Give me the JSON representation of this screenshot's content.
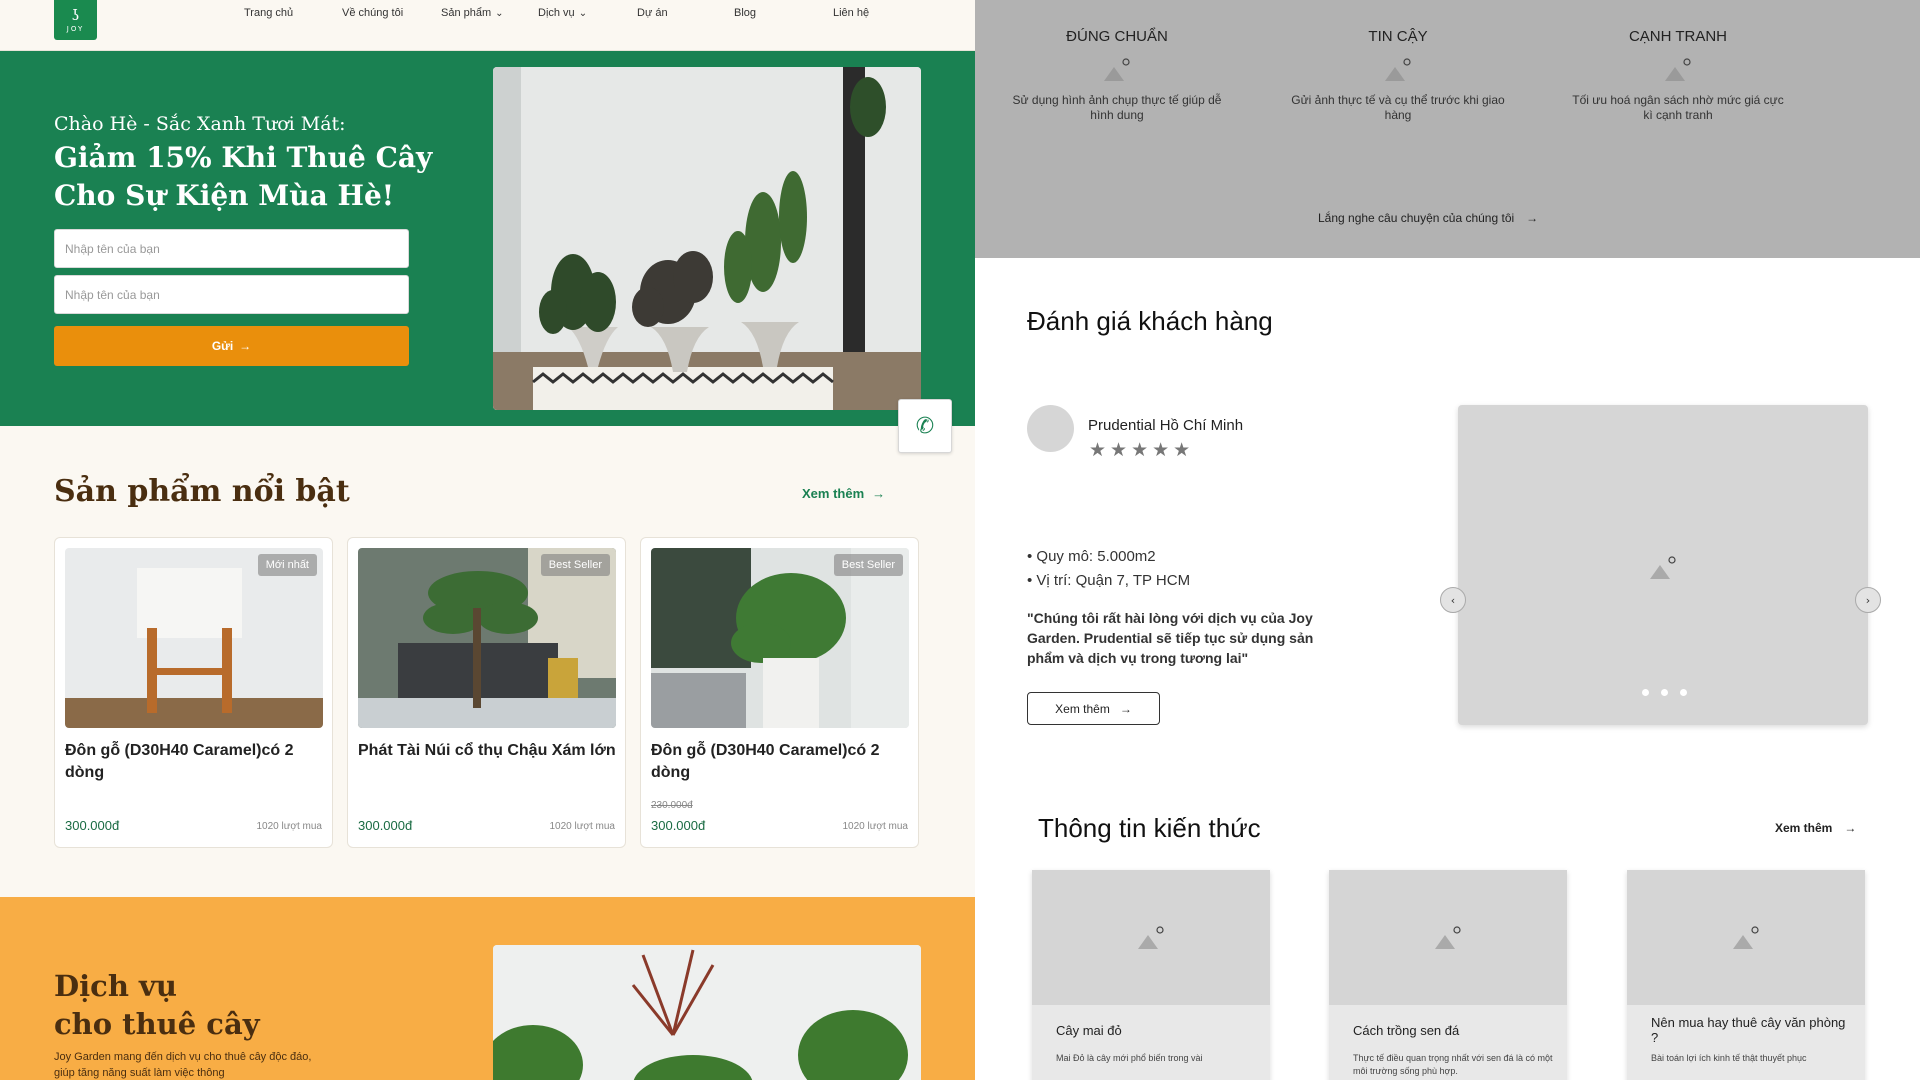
{
  "left": {
    "logo_text": "JOY",
    "nav": [
      "Trang chủ",
      "Về chúng tôi",
      "Sản phẩm",
      "Dịch vụ",
      "Dự án",
      "Blog",
      "Liên hệ"
    ],
    "hero": {
      "subtitle": "Chào Hè - Sắc Xanh Tươi Mát:",
      "title": "Giảm 15% Khi Thuê Cây Cho Sự Kiện Mùa Hè!",
      "input1_placeholder": "Nhập tên của bạn",
      "input2_placeholder": "Nhập tên của bạn",
      "submit_label": "Gửi"
    },
    "featured": {
      "title": "Sản phẩm nổi bật",
      "see_more": "Xem thêm",
      "products": [
        {
          "badge": "Mới nhất",
          "name": "Đôn gỗ (D30H40 Caramel)có 2 dòng",
          "old_price": "",
          "price": "300.000đ",
          "sold": "1020 lượt mua"
        },
        {
          "badge": "Best Seller",
          "name": "Phát Tài Núi cổ thụ Chậu Xám lớn",
          "old_price": "",
          "price": "300.000đ",
          "sold": "1020 lượt mua"
        },
        {
          "badge": "Best Seller",
          "name": "Đôn gỗ (D30H40 Caramel)có 2 dòng",
          "old_price": "230.000đ",
          "price": "300.000đ",
          "sold": "1020 lượt mua"
        }
      ]
    },
    "service": {
      "title_line1": "Dịch vụ",
      "title_line2": "cho thuê cây",
      "desc": "Joy Garden mang đến dịch vụ cho thuê cây độc đáo, giúp tăng năng suất làm việc thông"
    }
  },
  "right": {
    "features": [
      {
        "title": "ĐÚNG CHUẨN",
        "desc": "Sử dụng hình ảnh chụp thực tế giúp dễ hình dung"
      },
      {
        "title": "TIN CẬY",
        "desc": "Gửi ảnh thực tế và cụ thể trước khi giao hàng"
      },
      {
        "title": "CẠNH TRANH",
        "desc": "Tối ưu hoá ngân sách nhờ mức giá cực kì cạnh tranh"
      }
    ],
    "story_link": "Lắng nghe câu chuyện của chúng tôi",
    "reviews": {
      "title": "Đánh giá khách hàng",
      "name": "Prudential Hồ Chí Minh",
      "stars": "★★★★★",
      "bullets": [
        "Quy mô: 5.000m2",
        "Vị trí: Quận 7, TP HCM"
      ],
      "quote": "\"Chúng tôi rất hài lòng với dịch vụ của Joy Garden. Prudential sẽ tiếp tục sử dụng sản phẩm và dịch vụ trong tương lai\"",
      "button": "Xem thêm"
    },
    "knowledge": {
      "title": "Thông tin kiến thức",
      "see_more": "Xem thêm",
      "cards": [
        {
          "title": "Cây mai đỏ",
          "desc": "Mai Đỏ là cây mới phổ biến trong vài"
        },
        {
          "title": "Cách trồng sen đá",
          "desc": "Thực tế điều quan trọng nhất với sen đá là có một môi trường sống phù hợp."
        },
        {
          "title": "Nên mua hay thuê cây văn phòng ?",
          "desc": "Bài toán lợi ích kinh tế thật thuyết phục"
        }
      ]
    }
  },
  "colors": {
    "green": "#1a8152",
    "orange": "#ea8f0c",
    "service_bg": "#f8ad45",
    "brown": "#4a2e10",
    "wireframe_gray": "#b2b2b2"
  }
}
